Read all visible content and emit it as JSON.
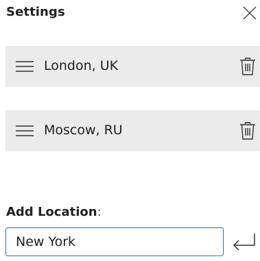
{
  "header": {
    "title": "Settings",
    "close_icon": "close-icon"
  },
  "locations": [
    {
      "label": "London, UK",
      "handle_icon": "drag-handle-icon",
      "delete_icon": "trash-icon"
    },
    {
      "label": "Moscow, RU",
      "handle_icon": "drag-handle-icon",
      "delete_icon": "trash-icon"
    }
  ],
  "add_location": {
    "label": "Add Location",
    "colon": ":",
    "input_value": "New York",
    "submit_icon": "enter-return-icon"
  },
  "colors": {
    "item_background": "#ebebeb",
    "input_border": "#1a73c8",
    "text": "#1f1f1f"
  }
}
